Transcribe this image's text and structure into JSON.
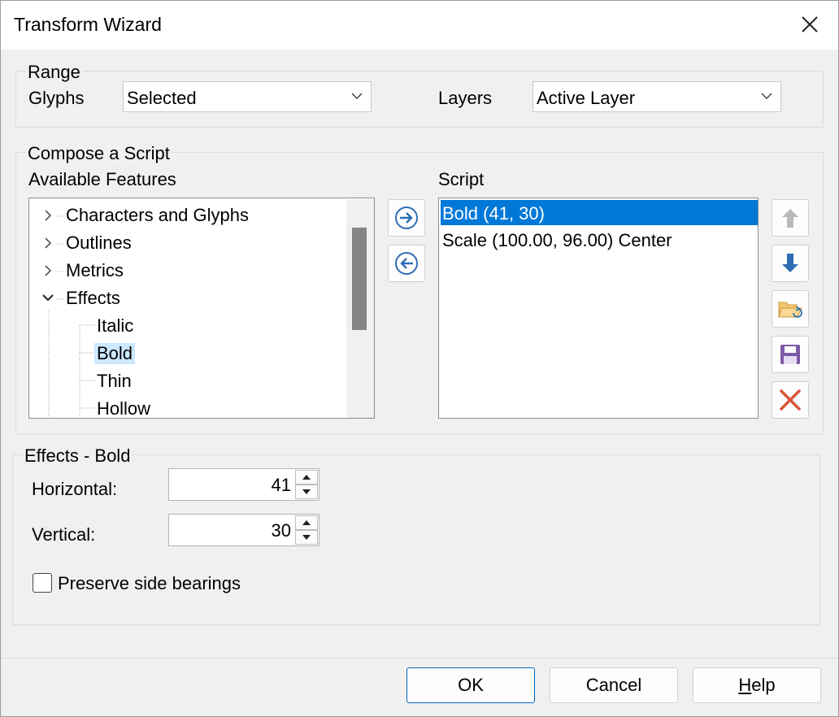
{
  "window": {
    "title": "Transform Wizard"
  },
  "range": {
    "group_label": "Range",
    "glyphs_label": "Glyphs",
    "glyphs_value": "Selected",
    "layers_label": "Layers",
    "layers_value": "Active Layer"
  },
  "compose": {
    "group_label": "Compose a Script",
    "features_label": "Available Features",
    "script_label": "Script",
    "tree": [
      {
        "label": "Characters and Glyphs"
      },
      {
        "label": "Outlines"
      },
      {
        "label": "Metrics"
      },
      {
        "label": "Effects"
      },
      {
        "label": "Italic"
      },
      {
        "label": "Bold"
      },
      {
        "label": "Thin"
      },
      {
        "label": "Hollow"
      }
    ],
    "script_items": [
      {
        "label": "Bold (41, 30)"
      },
      {
        "label": "Scale (100.00, 96.00) Center"
      }
    ]
  },
  "effects": {
    "group_label": "Effects - Bold",
    "horizontal_label": "Horizontal:",
    "horizontal_value": "41",
    "vertical_label": "Vertical:",
    "vertical_value": "30",
    "preserve_label": "Preserve side bearings",
    "preserve_checked": false
  },
  "buttons": {
    "ok": "OK",
    "cancel": "Cancel",
    "help_first": "H",
    "help_rest": "elp"
  },
  "colors": {
    "selection": "#0078d7",
    "tree_selection": "#cce8ff",
    "arrow_blue": "#2f6db5",
    "delete_red": "#d9533c",
    "save_purple": "#7d5aa6"
  }
}
